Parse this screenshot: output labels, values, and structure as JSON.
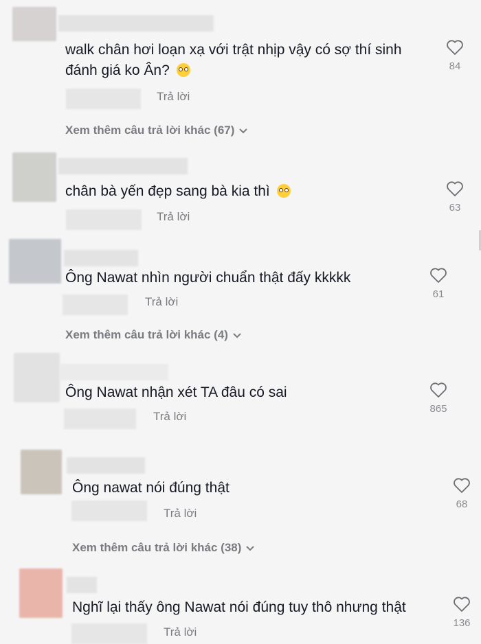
{
  "comments": [
    {
      "text": "walk chân hơi loạn xạ với trật nhịp vậy có sợ thí sinh đánh giá ko Ân?",
      "emoji": "flushed-face",
      "likes": "84",
      "reply": "Trả lời",
      "more": "Xem thêm câu trả lời khác (67)",
      "avatar_color": "#d6d2d2"
    },
    {
      "text": "chân bà yến đẹp sang bà kia thì",
      "emoji": "pleading-face",
      "likes": "63",
      "reply": "Trả lời",
      "avatar_color": "#cfcfcc"
    },
    {
      "text": "Ông Nawat nhìn người chuẩn thật đấy kkkkk",
      "likes": "61",
      "reply": "Trả lời",
      "more": "Xem thêm câu trả lời khác (4)",
      "avatar_color": "#c4c7cc"
    },
    {
      "text": "Ông Nawat nhận xét TA đâu có sai",
      "likes": "865",
      "reply": "Trả lời",
      "avatar_color": "#e2e2e2"
    },
    {
      "text": "Ông nawat nói đúng thật",
      "likes": "68",
      "reply": "Trả lời",
      "more": "Xem thêm câu trả lời khác (38)",
      "avatar_color": "#cbc4bb"
    },
    {
      "text": "Nghĩ lại thấy ông Nawat nói đúng tuy thô nhưng thật",
      "likes": "136",
      "reply": "Trả lời",
      "avatar_color": "#e9b5ab"
    }
  ],
  "icons": {
    "like": "heart-outline-icon",
    "expand": "chevron-down-icon"
  }
}
